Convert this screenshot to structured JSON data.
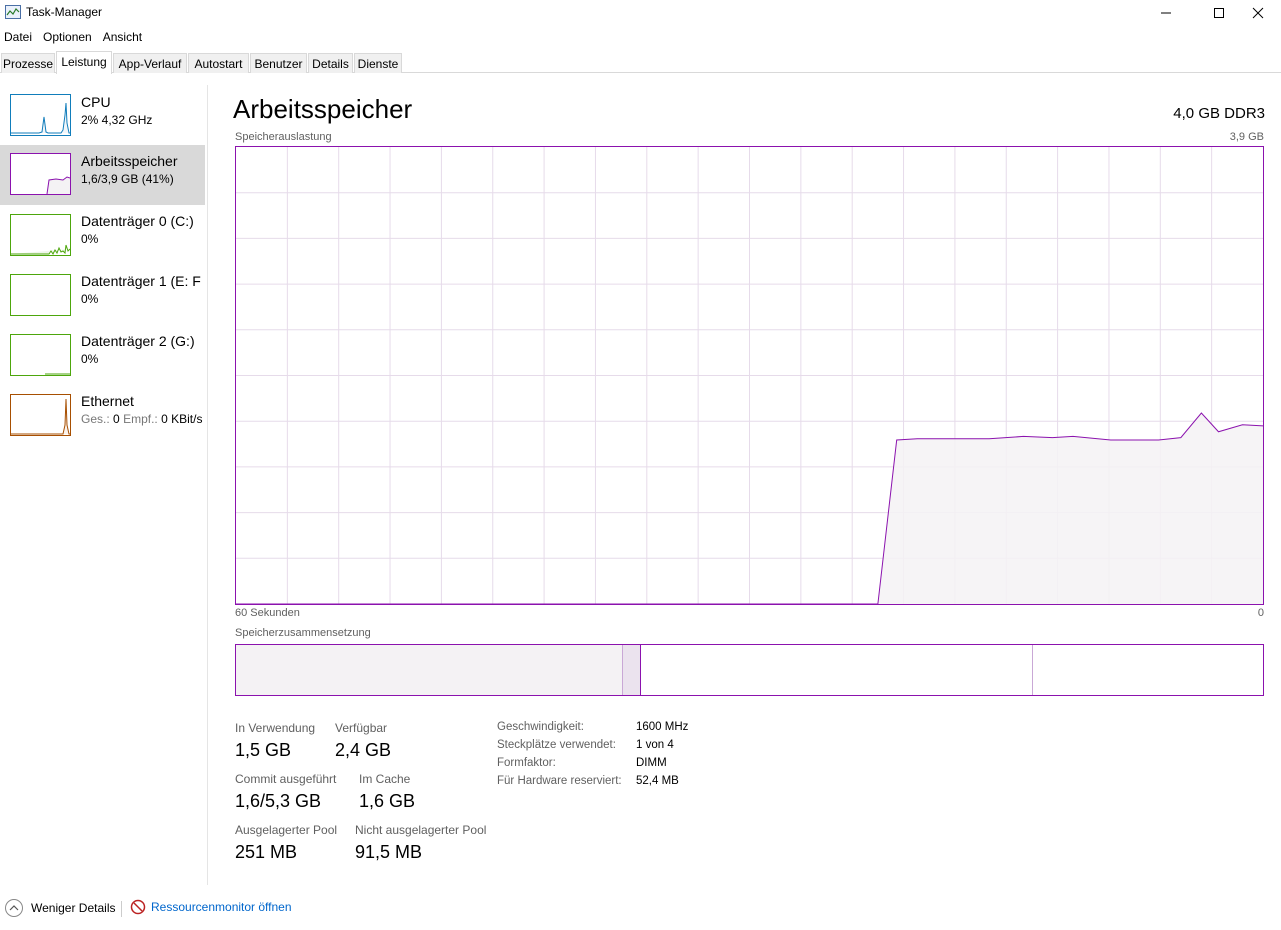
{
  "window": {
    "title": "Task-Manager"
  },
  "menu": [
    "Datei",
    "Optionen",
    "Ansicht"
  ],
  "tabs": [
    "Prozesse",
    "Leistung",
    "App-Verlauf",
    "Autostart",
    "Benutzer",
    "Details",
    "Dienste"
  ],
  "active_tab": "Leistung",
  "sidebar": {
    "items": [
      {
        "title": "CPU",
        "sub": "2%  4,32 GHz",
        "color": "#117dbb",
        "usage_percent": 2
      },
      {
        "title": "Arbeitsspeicher",
        "sub": "1,6/3,9 GB (41%)",
        "color": "#8b12ae",
        "usage_percent": 41
      },
      {
        "title": "Datenträger 0 (C:)",
        "sub": "0%",
        "color": "#4da60c",
        "usage_percent": 0
      },
      {
        "title": "Datenträger 1 (E: F",
        "sub": "0%",
        "color": "#4da60c",
        "usage_percent": 0
      },
      {
        "title": "Datenträger 2 (G:)",
        "sub": "0%",
        "color": "#4da60c",
        "usage_percent": 0
      },
      {
        "title": "Ethernet",
        "sub_label1": "Ges.:",
        "sub_val1": "0",
        "sub_label2": "Empf.:",
        "sub_val2": "0 KBit/s",
        "color": "#a74f01"
      }
    ]
  },
  "main": {
    "heading": "Arbeitsspeicher",
    "spec": "4,0 GB DDR3",
    "usage_label": "Speicherauslastung",
    "max_label": "3,9 GB",
    "time_label": "60 Sekunden",
    "zero_label": "0",
    "composition_label": "Speicherzusammensetzung",
    "stats": {
      "in_use_label": "In Verwendung",
      "in_use": "1,5 GB",
      "available_label": "Verfügbar",
      "available": "2,4 GB",
      "committed_label": "Commit ausgeführt",
      "committed": "1,6/5,3 GB",
      "cached_label": "Im Cache",
      "cached": "1,6 GB",
      "paged_label": "Ausgelagerter Pool",
      "paged": "251 MB",
      "nonpaged_label": "Nicht ausgelagerter Pool",
      "nonpaged": "91,5 MB"
    },
    "props": [
      {
        "label": "Geschwindigkeit:",
        "value": "1600 MHz"
      },
      {
        "label": "Steckplätze verwendet:",
        "value": "1 von 4"
      },
      {
        "label": "Formfaktor:",
        "value": "DIMM"
      },
      {
        "label": "Für Hardware reserviert:",
        "value": "52,4 MB"
      }
    ]
  },
  "footer": {
    "fewer": "Weniger Details",
    "resmon": "Ressourcenmonitor öffnen"
  },
  "chart_data": {
    "type": "area",
    "x_range_seconds": [
      60,
      0
    ],
    "y_range_gb": [
      0,
      3.9
    ],
    "grid": true,
    "series": [
      {
        "x": [
          60,
          22.5,
          21.4,
          20.2,
          16.0,
          14.0,
          12.3,
          11.1,
          8.9,
          6.1,
          4.8,
          3.6,
          2.6,
          1.2,
          0
        ],
        "values": [
          0,
          0,
          1.4,
          1.41,
          1.41,
          1.43,
          1.42,
          1.43,
          1.4,
          1.4,
          1.42,
          1.63,
          1.47,
          1.53,
          1.52
        ]
      }
    ],
    "composition_gb": {
      "in_use": 1.5,
      "modified": 0.04,
      "standby": 1.6,
      "free": 0.8
    }
  }
}
